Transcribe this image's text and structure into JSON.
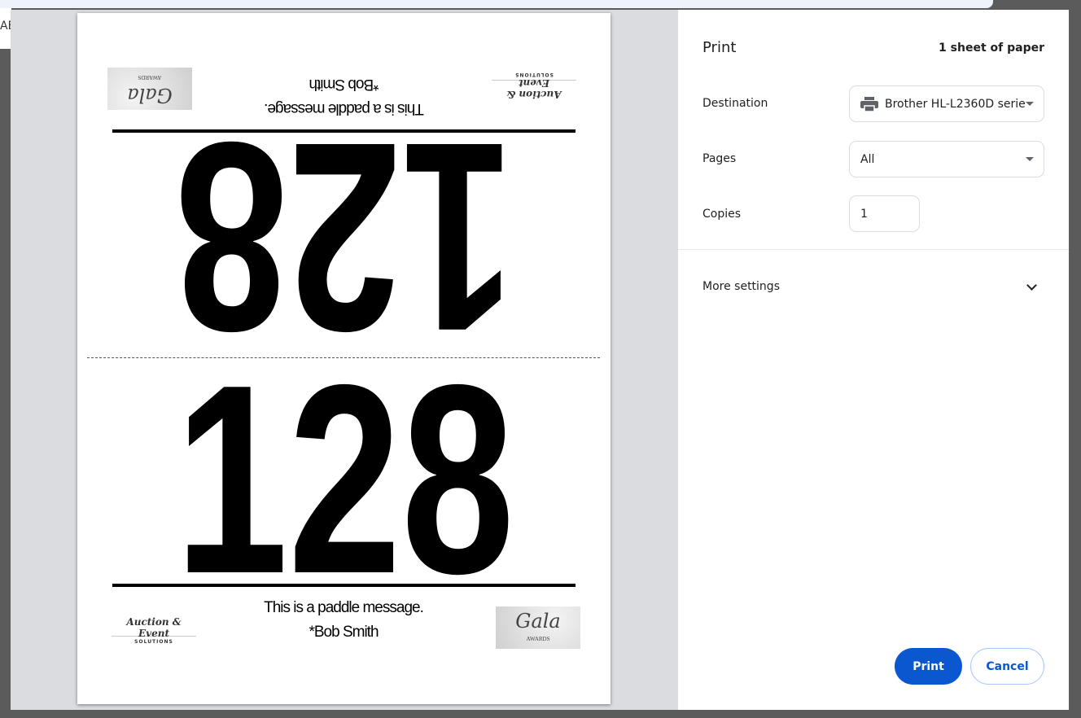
{
  "background_page": {
    "fragment": "AE"
  },
  "paddle": {
    "number": "128",
    "message": "This is a paddle message.",
    "signature": "*Bob Smith",
    "logo_auction": {
      "script": "Auction & Event",
      "sub": "SOLUTIONS"
    },
    "logo_gala": {
      "script": "Gala",
      "sub": "AWARDS"
    }
  },
  "print_panel": {
    "title": "Print",
    "sheet_count": "1 sheet of paper",
    "destination_label": "Destination",
    "destination_value": "Brother HL-L2360D serie",
    "pages_label": "Pages",
    "pages_value": "All",
    "copies_label": "Copies",
    "copies_value": "1",
    "more_settings": "More settings",
    "print_button": "Print",
    "cancel_button": "Cancel"
  }
}
